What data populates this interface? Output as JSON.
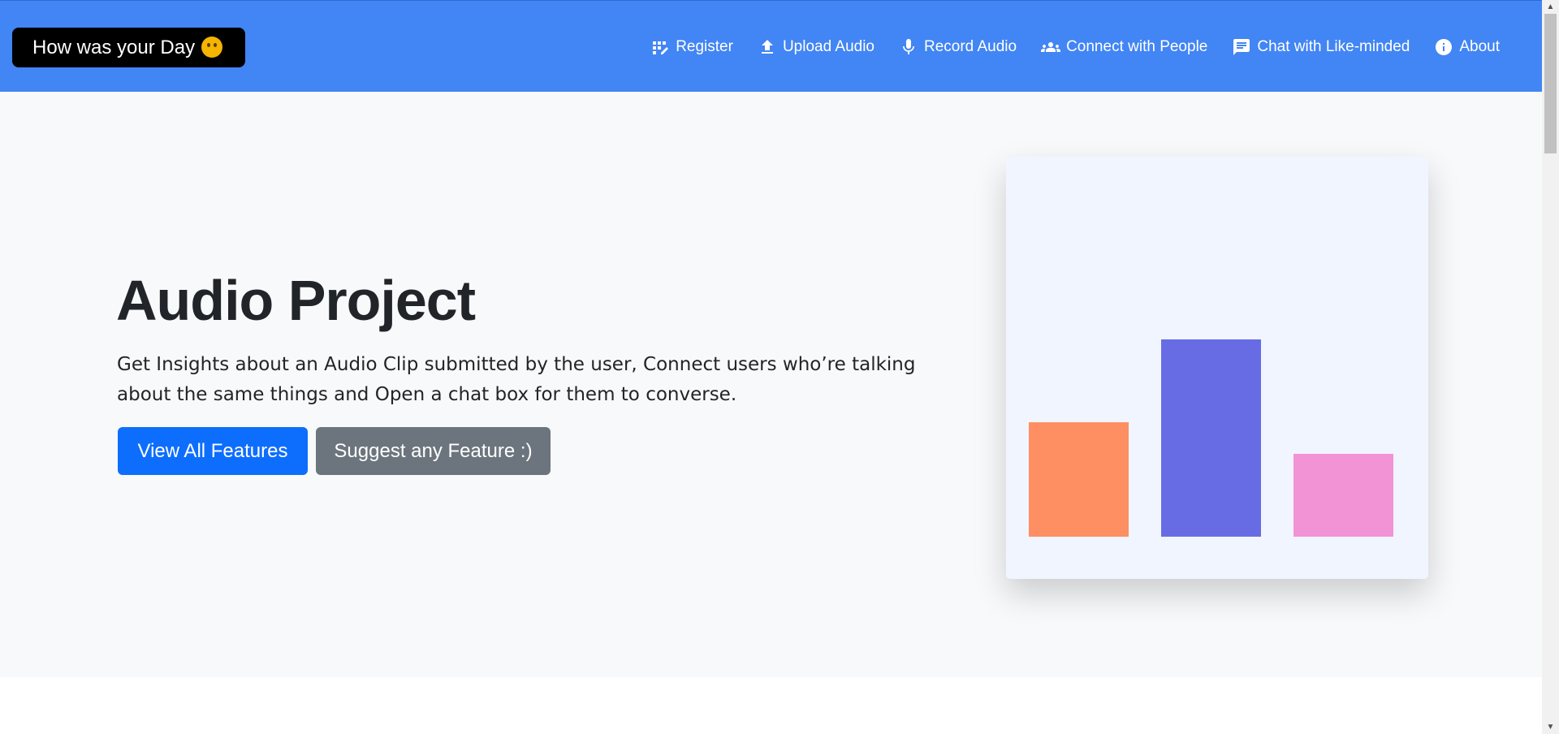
{
  "navbar": {
    "brand": "How was your Day",
    "items": [
      {
        "label": "Register",
        "icon": "register-icon"
      },
      {
        "label": "Upload Audio",
        "icon": "upload-icon"
      },
      {
        "label": "Record Audio",
        "icon": "microphone-icon"
      },
      {
        "label": "Connect with People",
        "icon": "people-icon"
      },
      {
        "label": "Chat with Like-minded",
        "icon": "chat-icon"
      },
      {
        "label": "About",
        "icon": "info-icon"
      }
    ]
  },
  "hero": {
    "title": "Audio Project",
    "description": "Get Insights about an Audio Clip submitted by the user, Connect users who’re talking about the same things and Open a chat box for them to converse.",
    "primary_button": "View All Features",
    "secondary_button": "Suggest any Feature :)"
  },
  "colors": {
    "navbar": "#4285f4",
    "primary": "#0d6efd",
    "secondary": "#6c757d"
  },
  "chart_data": {
    "type": "bar",
    "categories": [
      "",
      "",
      ""
    ],
    "values": [
      0.58,
      1.0,
      0.42
    ],
    "colors": [
      "#fd8f63",
      "#676ce5",
      "#f293d6"
    ]
  }
}
